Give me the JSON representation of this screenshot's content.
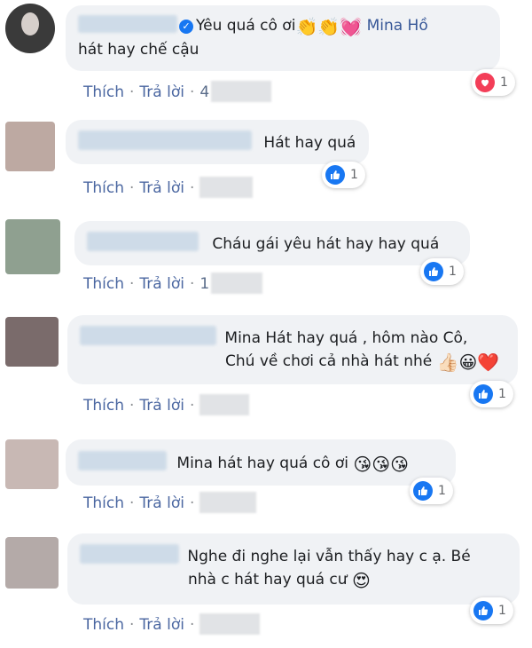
{
  "actions": {
    "like": "Thích",
    "reply": "Trả lời",
    "sep": "·"
  },
  "comments": [
    {
      "line1": "Yêu quá cô ơi",
      "line1_emojis": "👏👏💓",
      "mention": "Mina Hồ",
      "line2": "hát hay chế cậu",
      "time_partial": "4",
      "reaction": {
        "type": "love",
        "count": "1"
      }
    },
    {
      "text": "Hát hay quá",
      "reaction": {
        "type": "like",
        "count": "1"
      }
    },
    {
      "text": "Cháu gái yêu hát hay hay quá",
      "time_partial": "1",
      "reaction": {
        "type": "like",
        "count": "1"
      }
    },
    {
      "line1": "Mina Hát hay quá , hôm nào Cô,",
      "line2": "Chú về chơi cả nhà hát nhé",
      "emojis": "👍🏻😀❤️",
      "reaction": {
        "type": "like",
        "count": "1"
      }
    },
    {
      "text": "Mina hát hay quá cô ơi",
      "emojis": "😘😘😘",
      "reaction": {
        "type": "like",
        "count": "1"
      }
    },
    {
      "line1": "Nghe đi nghe lại vẫn thấy hay c ạ. Bé",
      "line2": "nhà c hát hay quá cư",
      "emojis": "😍",
      "reaction": {
        "type": "like",
        "count": "1"
      }
    }
  ]
}
